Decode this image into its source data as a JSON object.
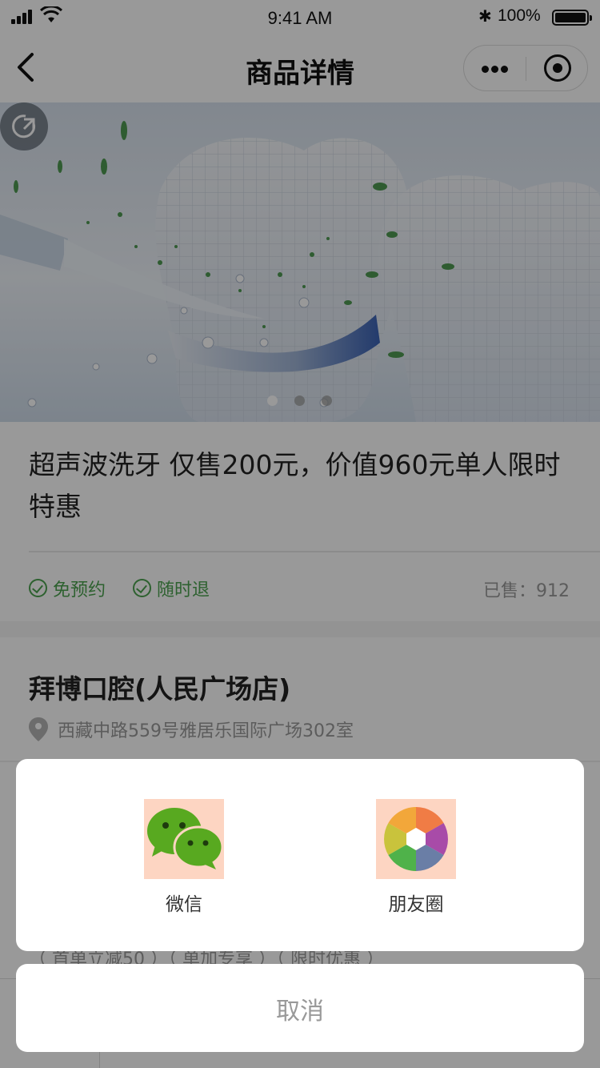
{
  "status_bar": {
    "time": "9:41 AM",
    "battery_percent": "100%",
    "battery_level": 1.0
  },
  "nav": {
    "title": "商品详情",
    "icons": [
      "back-icon",
      "more-icon",
      "close-miniprogram-icon"
    ]
  },
  "banner": {
    "slide_count": 3,
    "active_slide": 1,
    "icons": [
      "share-icon"
    ]
  },
  "product": {
    "title": "超声波洗牙 仅售200元，价值960元单人限时特惠",
    "tags": [
      "免预约",
      "随时退"
    ],
    "sold": "已售：912",
    "tag_color": "#4ca24f"
  },
  "store": {
    "name": "拜博口腔(人民广场店)",
    "address": "西藏中路559号雅居乐国际广场302室"
  },
  "coupons": {
    "text": "（ 首单立减50 ）（ 单加专享 ）（ 限时优惠 ）"
  },
  "share_sheet": {
    "options": [
      {
        "label": "微信",
        "icon": "wechat-icon"
      },
      {
        "label": "朋友圈",
        "icon": "moments-icon"
      }
    ],
    "cancel_label": "取消"
  },
  "colors": {
    "accent_green": "#4ca24f",
    "wechat_green": "#58a920",
    "icon_bg": "#fdd5c2"
  }
}
